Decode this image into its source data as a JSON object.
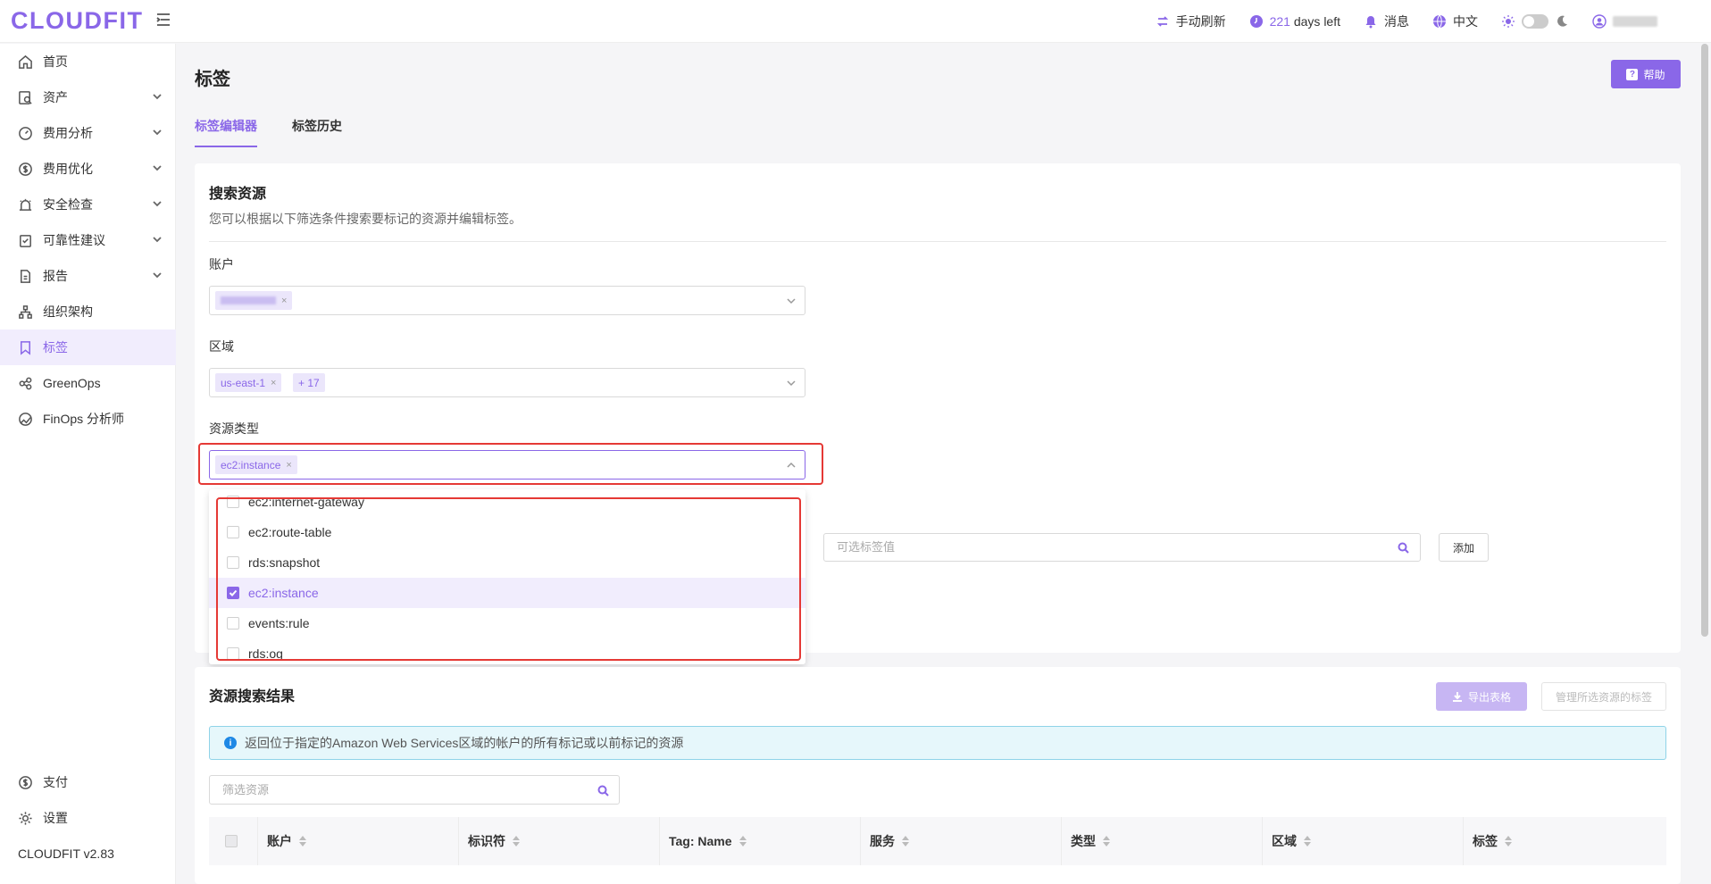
{
  "app": {
    "logo": "CLOUDFIT",
    "version": "CLOUDFIT v2.83"
  },
  "topbar": {
    "refresh": "手动刷新",
    "days_num": "221",
    "days_text": "days left",
    "messages": "消息",
    "language": "中文"
  },
  "sidebar": {
    "items": [
      {
        "label": "首页",
        "icon": "home-icon"
      },
      {
        "label": "资产",
        "icon": "asset-icon"
      },
      {
        "label": "费用分析",
        "icon": "gauge-icon"
      },
      {
        "label": "费用优化",
        "icon": "dollar-icon"
      },
      {
        "label": "安全检查",
        "icon": "alarm-icon"
      },
      {
        "label": "可靠性建议",
        "icon": "clipboard-icon"
      },
      {
        "label": "报告",
        "icon": "document-icon"
      },
      {
        "label": "组织架构",
        "icon": "org-icon"
      },
      {
        "label": "标签",
        "icon": "bookmark-icon"
      },
      {
        "label": "GreenOps",
        "icon": "leaf-icon"
      },
      {
        "label": "FinOps 分析师",
        "icon": "analyst-icon"
      }
    ],
    "support": "支付",
    "settings": "设置"
  },
  "page": {
    "title": "标签",
    "help": "帮助",
    "tabs": [
      "标签编辑器",
      "标签历史"
    ]
  },
  "search": {
    "title": "搜索资源",
    "desc": "您可以根据以下筛选条件搜索要标记的资源并编辑标签。",
    "account_label": "账户",
    "region_label": "区域",
    "region_chip": "us-east-1",
    "region_more": "+ 17",
    "resource_type_label": "资源类型",
    "resource_type_chip": "ec2:instance",
    "options": [
      {
        "label": "ec2:internet-gateway",
        "checked": false
      },
      {
        "label": "ec2:route-table",
        "checked": false
      },
      {
        "label": "rds:snapshot",
        "checked": false
      },
      {
        "label": "ec2:instance",
        "checked": true
      },
      {
        "label": "events:rule",
        "checked": false
      },
      {
        "label": "rds:og",
        "checked": false
      }
    ],
    "tag_value_placeholder": "可选标签值",
    "add": "添加"
  },
  "results": {
    "title": "资源搜索结果",
    "export": "导出表格",
    "manage": "管理所选资源的标签",
    "info": "返回位于指定的Amazon Web Services区域的帐户的所有标记或以前标记的资源",
    "filter_placeholder": "筛选资源",
    "columns": [
      "账户",
      "标识符",
      "Tag: Name",
      "服务",
      "类型",
      "区域",
      "标签"
    ]
  },
  "colors": {
    "accent": "#8a67e8",
    "highlight": "#e53935",
    "info_bg": "#e6f7fb"
  }
}
